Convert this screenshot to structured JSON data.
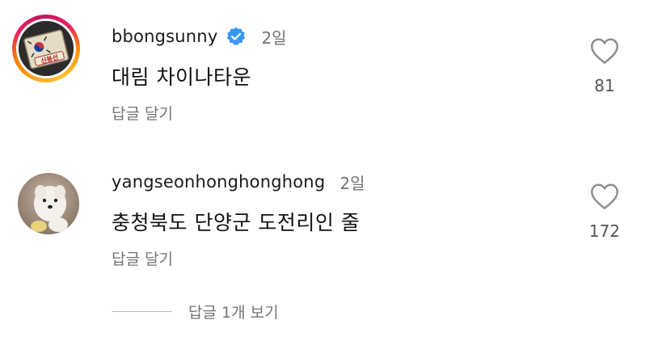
{
  "comments": [
    {
      "username": "bbongsunny",
      "verified": true,
      "time": "2일",
      "text": "대림 차이나타운",
      "reply_label": "답글 달기",
      "like_count": "81",
      "avatar_text": "신봉선"
    },
    {
      "username": "yangseonhonghonghong",
      "verified": false,
      "time": "2일",
      "text": "충청북도 단양군 도전리인 줄",
      "reply_label": "답글 달기",
      "like_count": "172"
    }
  ],
  "view_replies_label": "답글 1개 보기",
  "colors": {
    "verified_blue": "#3897f0",
    "secondary_text": "#737373"
  }
}
